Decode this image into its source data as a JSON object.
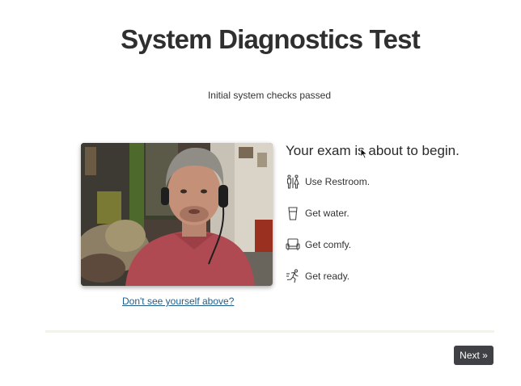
{
  "page": {
    "title": "System Diagnostics Test",
    "subtitle": "Initial system checks passed"
  },
  "camera": {
    "help_link": "Don't see yourself above?"
  },
  "exam": {
    "heading": "Your exam is about to begin.",
    "checklist": [
      {
        "label": "Use Restroom.",
        "icon": "restroom-icon"
      },
      {
        "label": "Get water.",
        "icon": "water-glass-icon"
      },
      {
        "label": "Get comfy.",
        "icon": "armchair-icon"
      },
      {
        "label": "Get ready.",
        "icon": "runner-icon"
      }
    ]
  },
  "footer": {
    "next_label": "Next »"
  },
  "colors": {
    "title": "#2f2f2f",
    "link": "#1f5e8c",
    "button_bg": "#3f4144",
    "divider": "#eef6e4"
  }
}
